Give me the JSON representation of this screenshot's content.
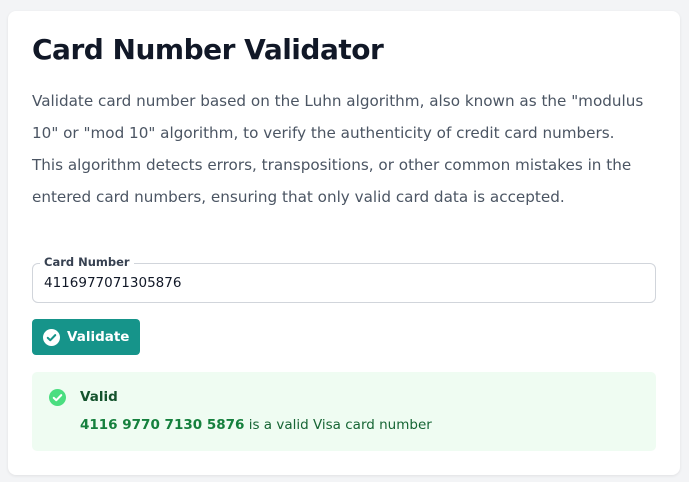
{
  "header": {
    "title": "Card Number Validator",
    "description": "Validate card number based on the Luhn algorithm, also known as the \"modulus 10\" or \"mod 10\" algorithm, to verify the authenticity of credit card numbers. This algorithm detects errors, transpositions, or other common mistakes in the entered card numbers, ensuring that only valid card data is accepted."
  },
  "form": {
    "card_number_label": "Card Number",
    "card_number_value": "4116977071305876",
    "validate_label": "Validate",
    "validate_icon": "check-circle-icon"
  },
  "result": {
    "icon": "check-circle-icon",
    "status": "Valid",
    "formatted_number": "4116 9770 7130 5876",
    "message": " is a valid Visa card number"
  },
  "colors": {
    "button": "#16948a",
    "success_bg": "#effcf2",
    "success_icon": "#4ade80",
    "success_text": "#166534"
  }
}
